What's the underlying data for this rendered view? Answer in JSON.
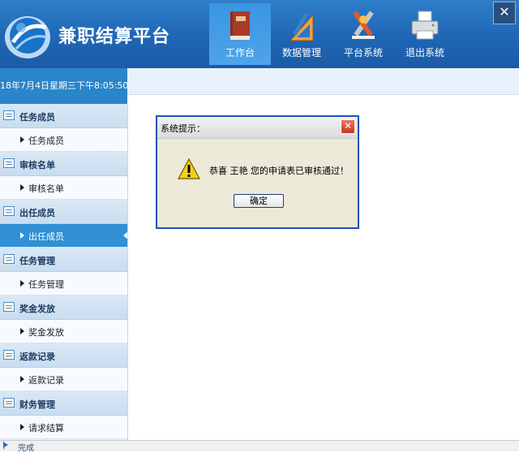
{
  "app": {
    "title": "兼职结算平台"
  },
  "nav": [
    {
      "label": "工作台",
      "icon": "book-icon",
      "active": true
    },
    {
      "label": "数据管理",
      "icon": "ruler-pencil-icon",
      "active": false
    },
    {
      "label": "平台系统",
      "icon": "tools-icon",
      "active": false
    },
    {
      "label": "退出系统",
      "icon": "printer-icon",
      "active": false
    }
  ],
  "datetime": "18年7月4日星期三下午8:05:50",
  "sidebar": [
    {
      "title": "任务成员",
      "icon": "list-icon",
      "items": [
        {
          "label": "任务成员",
          "active": false
        }
      ]
    },
    {
      "title": "审核名单",
      "icon": "message-icon",
      "items": [
        {
          "label": "审核名单",
          "active": false
        }
      ]
    },
    {
      "title": "出任成员",
      "icon": "edit-icon",
      "items": [
        {
          "label": "出任成员",
          "active": true
        }
      ]
    },
    {
      "title": "任务管理",
      "icon": "calendar-icon",
      "items": [
        {
          "label": "任务管理",
          "active": false
        }
      ]
    },
    {
      "title": "奖金发放",
      "icon": "calendar-icon",
      "items": [
        {
          "label": "奖金发放",
          "active": false
        }
      ]
    },
    {
      "title": "返款记录",
      "icon": "calendar-icon",
      "items": [
        {
          "label": "返款记录",
          "active": false
        }
      ]
    },
    {
      "title": "财务管理",
      "icon": "edit-icon",
      "items": [
        {
          "label": "请求结算",
          "active": false
        }
      ]
    }
  ],
  "status": {
    "text": "完成"
  },
  "dialog": {
    "title": "系统提示：",
    "message": "恭喜 王艳 您的申请表已审核通过！",
    "ok_label": "确定",
    "close_glyph": "✕"
  },
  "window": {
    "close_glyph": "✕"
  },
  "colors": {
    "header_blue": "#1f66b5",
    "active_item": "#2f90d6",
    "dialog_border": "#1d52b9"
  }
}
